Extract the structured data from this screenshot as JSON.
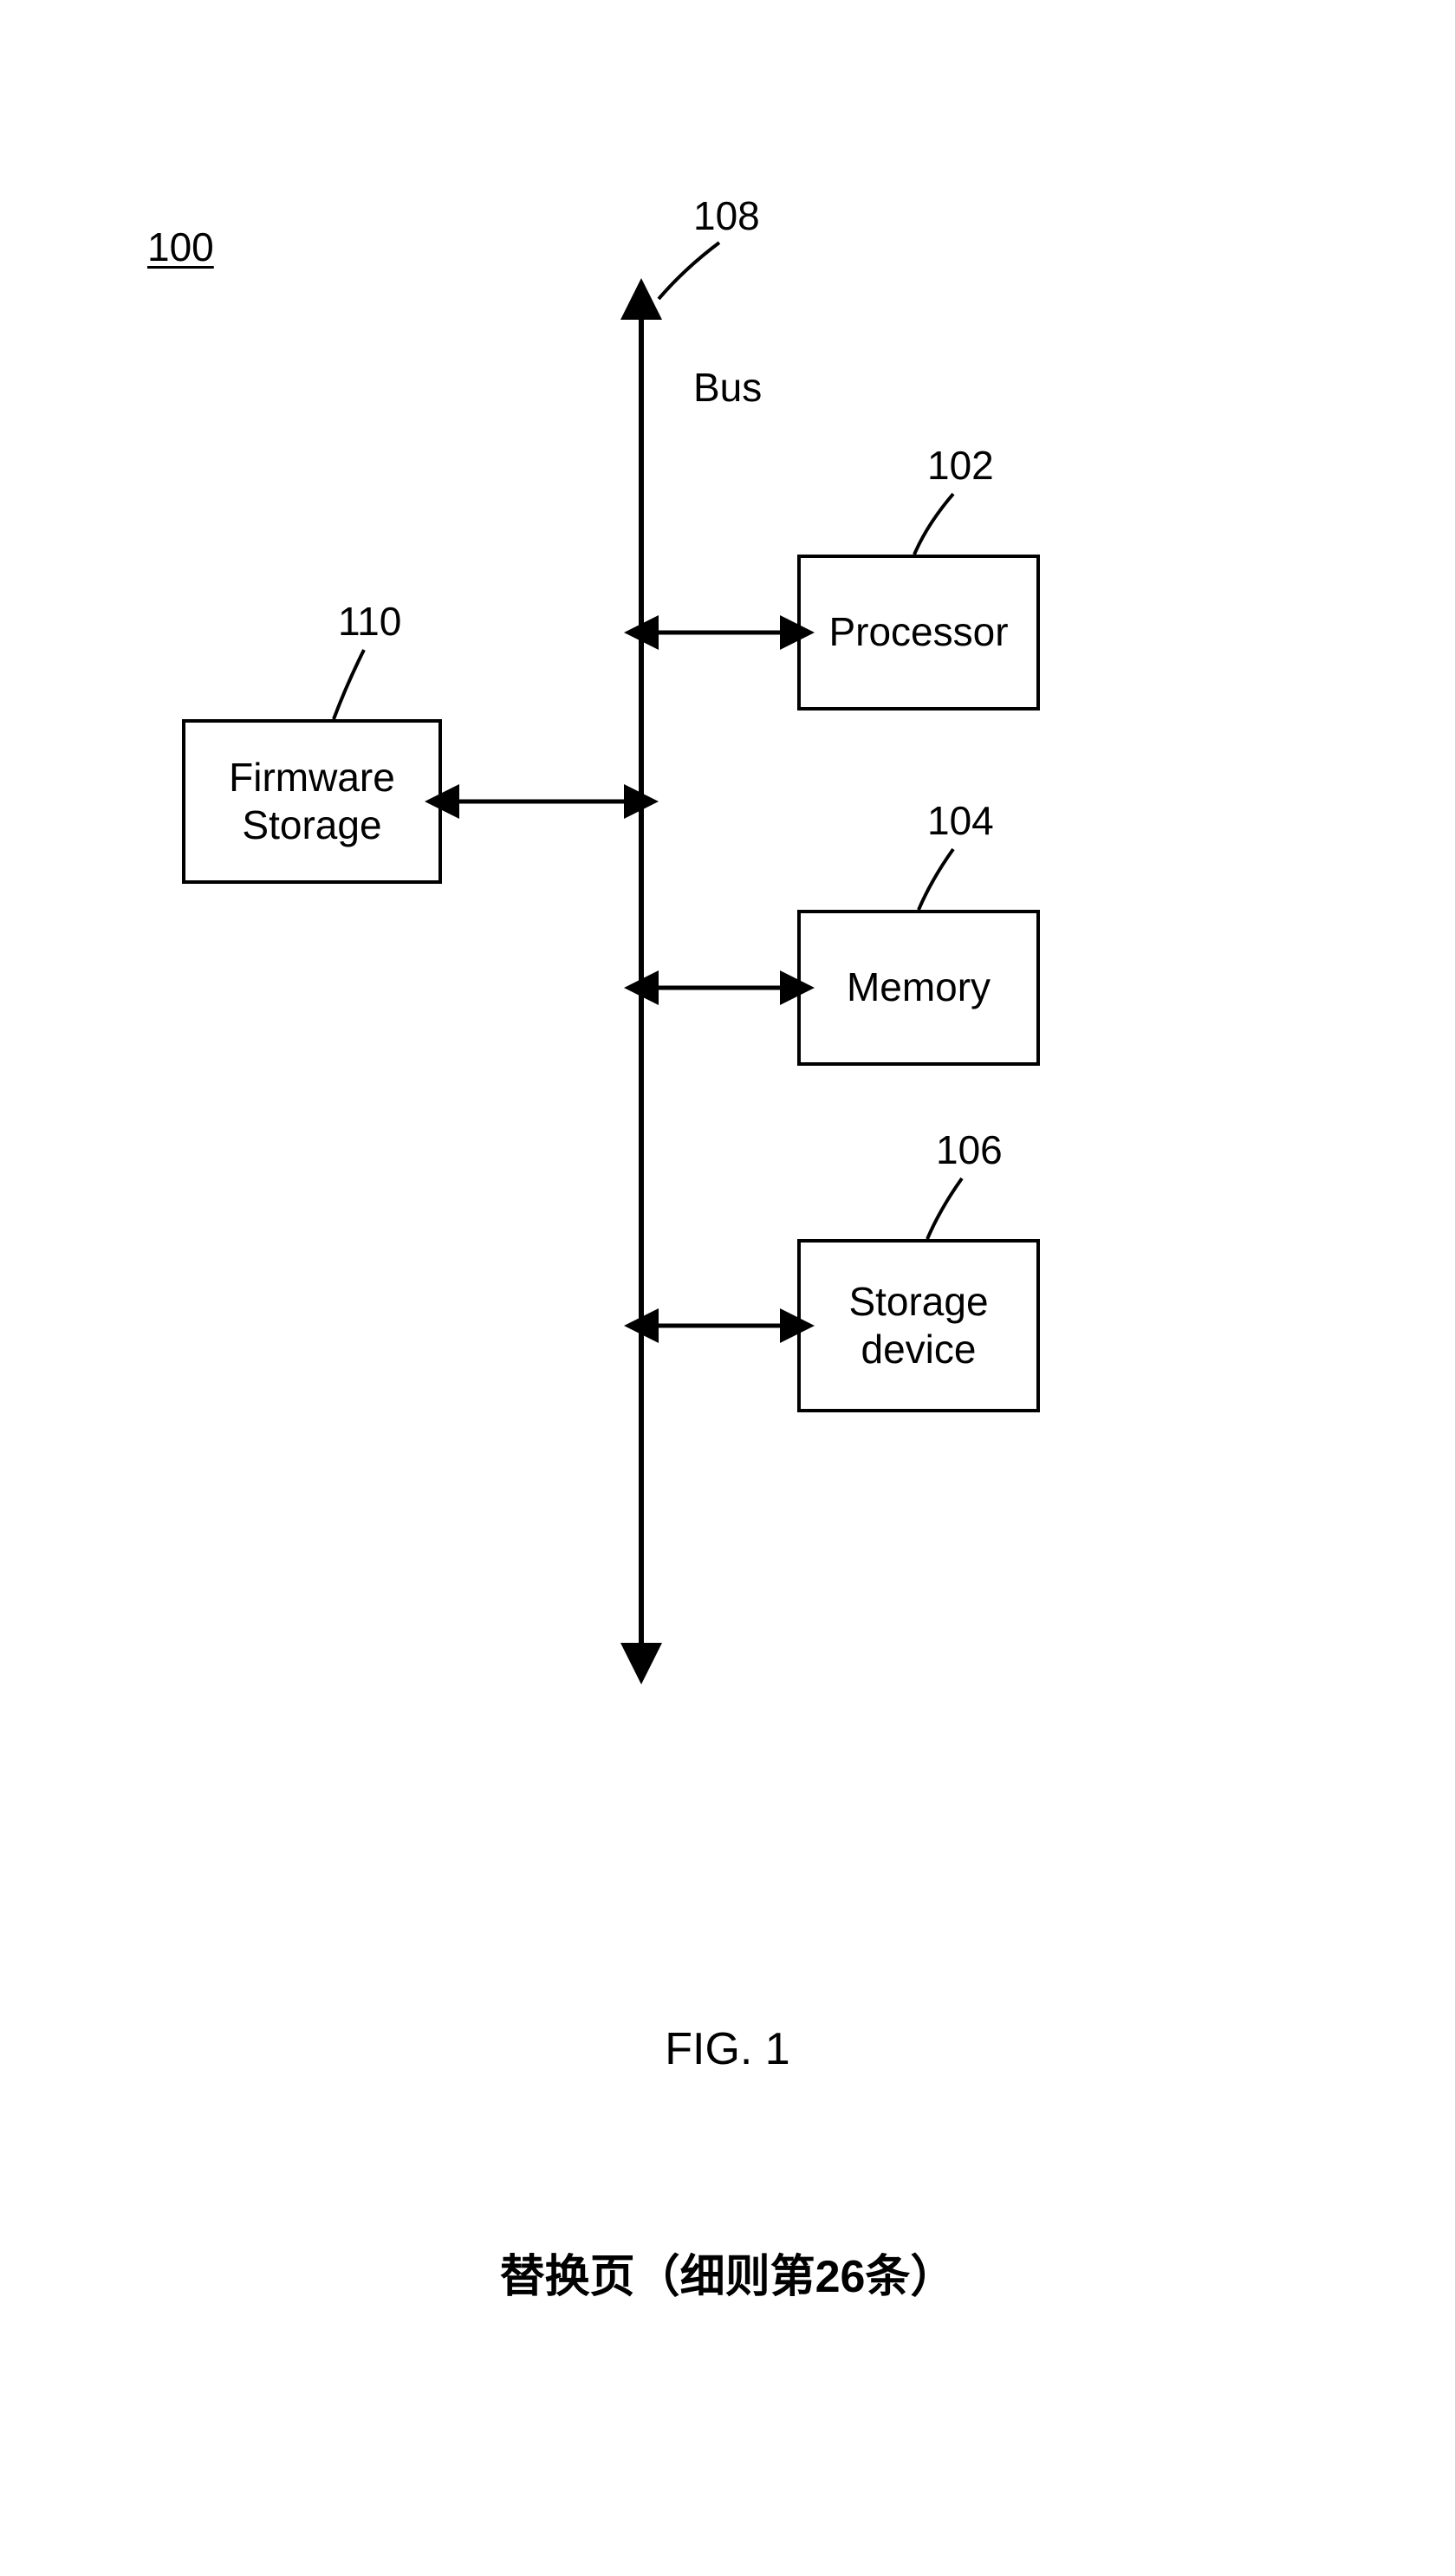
{
  "diagram": {
    "id": "100",
    "figure_label": "FIG. 1",
    "footer_text": "替换页（细则第26条）",
    "bus": {
      "label": "Bus",
      "ref": "108"
    },
    "nodes": {
      "firmware_storage": {
        "label": "Firmware\nStorage",
        "ref": "110"
      },
      "processor": {
        "label": "Processor",
        "ref": "102"
      },
      "memory": {
        "label": "Memory",
        "ref": "104"
      },
      "storage_device": {
        "label": "Storage\ndevice",
        "ref": "106"
      }
    }
  }
}
